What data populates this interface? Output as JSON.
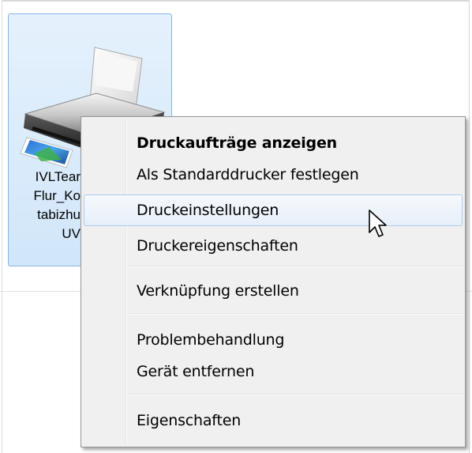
{
  "device": {
    "label_lines": [
      "IVLTear",
      "Flur_Ko",
      "tabizhu",
      "UV"
    ],
    "icon": "printer-icon"
  },
  "context_menu": {
    "items": [
      {
        "label": "Druckaufträge anzeigen",
        "bold": true
      },
      {
        "label": "Als Standarddrucker festlegen"
      },
      {
        "label": "Druckeinstellungen",
        "highlighted": true
      },
      {
        "label": "Druckereigenschaften"
      },
      {
        "label": "Verknüpfung erstellen"
      },
      {
        "label": "Problembehandlung"
      },
      {
        "label": "Gerät entfernen"
      },
      {
        "label": "Eigenschaften"
      }
    ]
  },
  "colors": {
    "selection_fill": "#d1e6fa",
    "selection_border": "#82b4e8",
    "menu_background": "#f0f0f0",
    "menu_hover_border": "#aeccee"
  },
  "cursor": "arrow-cursor-icon"
}
